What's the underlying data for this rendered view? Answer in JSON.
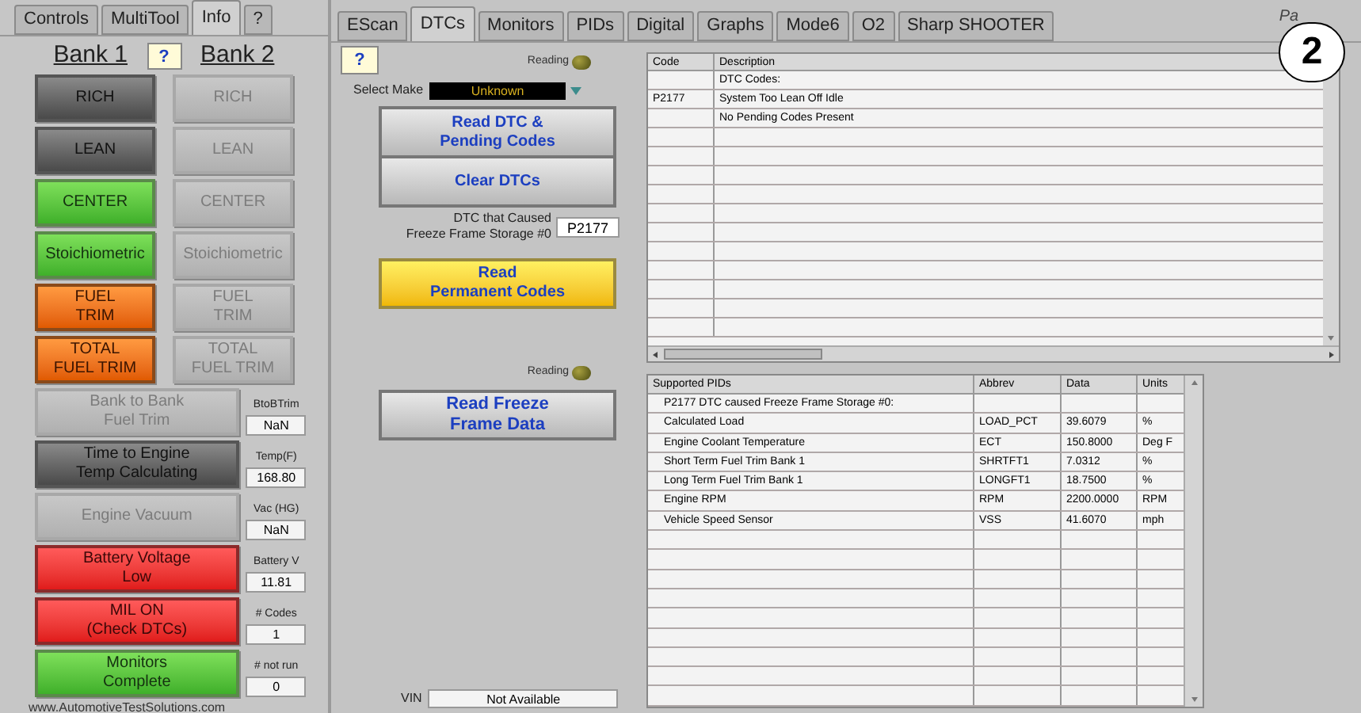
{
  "left_tabs": [
    {
      "label": "Controls",
      "selected": false
    },
    {
      "label": "MultiTool",
      "selected": false
    },
    {
      "label": "Info",
      "selected": true
    },
    {
      "label": "?",
      "selected": false
    }
  ],
  "bank_header": {
    "bank1": "Bank 1",
    "help": "?",
    "bank2": "Bank 2"
  },
  "bank_rows": [
    {
      "bank1": {
        "label": "RICH",
        "kind": "dark"
      },
      "bank2": {
        "label": "RICH",
        "kind": "off"
      }
    },
    {
      "bank1": {
        "label": "LEAN",
        "kind": "dark"
      },
      "bank2": {
        "label": "LEAN",
        "kind": "off"
      }
    },
    {
      "bank1": {
        "label": "CENTER",
        "kind": "green"
      },
      "bank2": {
        "label": "CENTER",
        "kind": "off"
      }
    },
    {
      "bank1": {
        "label": "Stoichiometric",
        "kind": "green"
      },
      "bank2": {
        "label": "Stoichiometric",
        "kind": "off"
      }
    },
    {
      "bank1": {
        "label": "FUEL\nTRIM",
        "kind": "orange"
      },
      "bank2": {
        "label": "FUEL\nTRIM",
        "kind": "off"
      }
    },
    {
      "bank1": {
        "label": "TOTAL\nFUEL TRIM",
        "kind": "orange"
      },
      "bank2": {
        "label": "TOTAL\nFUEL TRIM",
        "kind": "off"
      }
    }
  ],
  "indicators": [
    {
      "label": "Bank to Bank\nFuel Trim",
      "kind": "off",
      "reading_label": "BtoBTrim",
      "reading": "NaN"
    },
    {
      "label": "Time to Engine\nTemp Calculating",
      "kind": "dark",
      "reading_label": "Temp(F)",
      "reading": "168.80"
    },
    {
      "label": "Engine Vacuum",
      "kind": "off",
      "reading_label": "Vac (HG)",
      "reading": "NaN"
    },
    {
      "label": "Battery Voltage\nLow",
      "kind": "red",
      "reading_label": "Battery V",
      "reading": "11.81"
    },
    {
      "label": "MIL ON\n(Check DTCs)",
      "kind": "red",
      "reading_label": "# Codes",
      "reading": "1"
    },
    {
      "label": "Monitors\nComplete",
      "kind": "green",
      "reading_label": "# not run",
      "reading": "0"
    }
  ],
  "footer_link": "www.AutomotiveTestSolutions.com",
  "tabs": [
    {
      "label": "EScan",
      "selected": false
    },
    {
      "label": "DTCs",
      "selected": true
    },
    {
      "label": "Monitors",
      "selected": false
    },
    {
      "label": "PIDs",
      "selected": false
    },
    {
      "label": "Digital",
      "selected": false
    },
    {
      "label": "Graphs",
      "selected": false
    },
    {
      "label": "Mode6",
      "selected": false
    },
    {
      "label": "O2",
      "selected": false
    },
    {
      "label": "Sharp SHOOTER",
      "selected": false
    }
  ],
  "header_right_text": "Pa",
  "callout_number": "2",
  "help_button": "?",
  "reading_label_1": "Reading",
  "select_make": {
    "label": "Select Make",
    "value": "Unknown"
  },
  "dtc_buttons": [
    "Read DTC &\nPending Codes",
    "Clear DTCs"
  ],
  "freeze_frame_dtc": {
    "label": "DTC that Caused\nFreeze Frame Storage #0",
    "value": "P2177"
  },
  "permanent_button": "Read\nPermanent Codes",
  "reading_label_2": "Reading",
  "freeze_button": "Read Freeze\nFrame Data",
  "vin": {
    "label": "VIN",
    "value": "Not Available"
  },
  "dtc_table": {
    "columns": [
      "Code",
      "Description"
    ],
    "rows": [
      {
        "code": "",
        "description": "DTC Codes:"
      },
      {
        "code": "P2177",
        "description": "System Too Lean Off Idle"
      },
      {
        "code": "",
        "description": "No Pending Codes Present"
      }
    ]
  },
  "pid_table": {
    "columns": [
      "Supported PIDs",
      "Abbrev",
      "Data",
      "Units"
    ],
    "rows": [
      {
        "pid": "P2177 DTC caused Freeze Frame Storage #0:",
        "abbrev": "",
        "data": "",
        "units": ""
      },
      {
        "pid": "Calculated Load",
        "abbrev": "LOAD_PCT",
        "data": "39.6079",
        "units": "%"
      },
      {
        "pid": "Engine Coolant Temperature",
        "abbrev": "ECT",
        "data": "150.8000",
        "units": "Deg F"
      },
      {
        "pid": "Short Term Fuel Trim Bank 1",
        "abbrev": "SHRTFT1",
        "data": "7.0312",
        "units": "%"
      },
      {
        "pid": "Long Term Fuel Trim Bank 1",
        "abbrev": "LONGFT1",
        "data": "18.7500",
        "units": "%"
      },
      {
        "pid": "Engine RPM",
        "abbrev": "RPM",
        "data": "2200.0000",
        "units": "RPM"
      },
      {
        "pid": "Vehicle Speed Sensor",
        "abbrev": "VSS",
        "data": "41.6070",
        "units": "mph"
      }
    ]
  }
}
